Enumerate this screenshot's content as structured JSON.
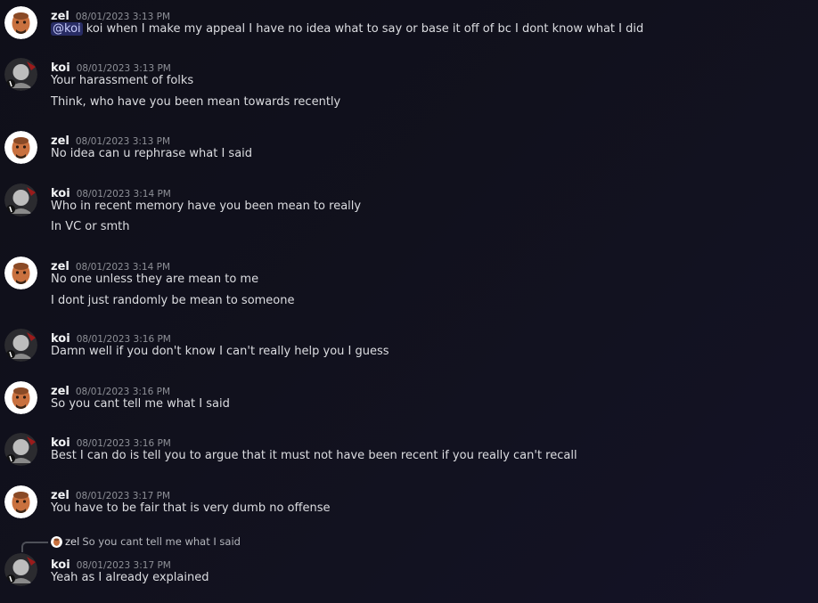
{
  "users": {
    "zel": {
      "name": "zel"
    },
    "koi": {
      "name": "koi"
    }
  },
  "messages": [
    {
      "author": "zel",
      "timestamp": "08/01/2023 3:13 PM",
      "mention": "@koi",
      "lines": [
        "koi when I make my appeal I have no idea what to say or base it off of bc I dont know what I did"
      ]
    },
    {
      "author": "koi",
      "timestamp": "08/01/2023 3:13 PM",
      "lines": [
        "Your harassment of folks",
        "Think, who have you been mean towards recently"
      ]
    },
    {
      "author": "zel",
      "timestamp": "08/01/2023 3:13 PM",
      "lines": [
        "No idea can u rephrase what I said"
      ]
    },
    {
      "author": "koi",
      "timestamp": "08/01/2023 3:14 PM",
      "lines": [
        "Who in recent memory have you been mean to really",
        "In VC or smth"
      ]
    },
    {
      "author": "zel",
      "timestamp": "08/01/2023 3:14 PM",
      "lines": [
        "No one unless they are mean to me",
        "I dont just randomly be mean to someone"
      ]
    },
    {
      "author": "koi",
      "timestamp": "08/01/2023 3:16 PM",
      "lines": [
        "Damn well if you don't know I can't really help you I guess"
      ]
    },
    {
      "author": "zel",
      "timestamp": "08/01/2023 3:16 PM",
      "lines": [
        "So you cant tell me what I said"
      ]
    },
    {
      "author": "koi",
      "timestamp": "08/01/2023 3:16 PM",
      "lines": [
        "Best I can do is tell you to argue that it must not have been recent if you really can't recall"
      ]
    },
    {
      "author": "zel",
      "timestamp": "08/01/2023 3:17 PM",
      "lines": [
        "You have to be fair that is very dumb no offense"
      ]
    },
    {
      "author": "koi",
      "timestamp": "08/01/2023 3:17 PM",
      "reply": {
        "author": "zel",
        "text": "So you cant tell me what I said"
      },
      "lines": [
        "Yeah as I already explained"
      ]
    }
  ],
  "colors": {
    "background": "#11111d",
    "mention_bg": "#3b3f8a",
    "text": "#dcdde1",
    "timestamp": "#8e9097"
  }
}
